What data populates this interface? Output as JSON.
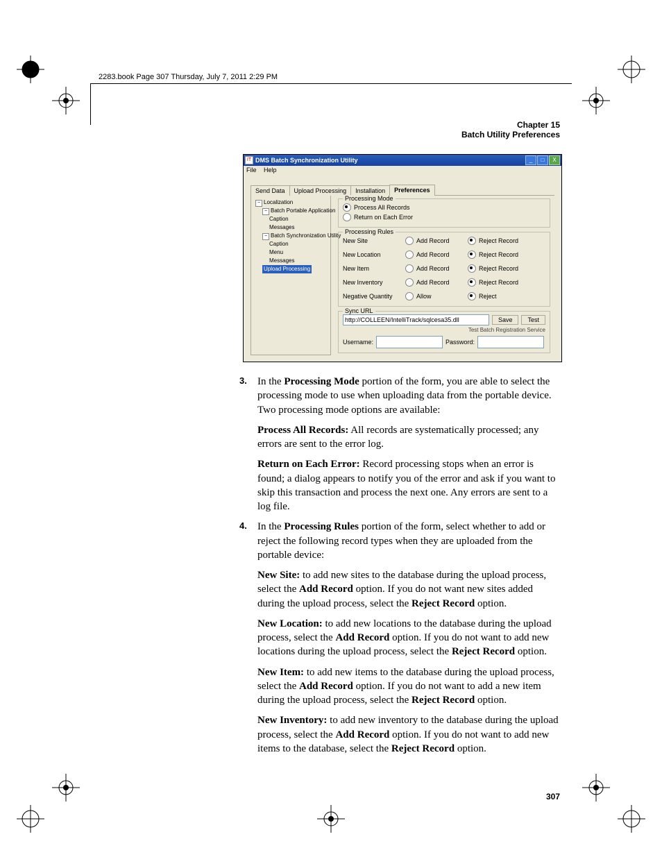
{
  "crop_text": "2283.book  Page 307  Thursday, July 7, 2011  2:29 PM",
  "header": {
    "chapter": "Chapter 15",
    "title": "Batch Utility Preferences"
  },
  "page_number": "307",
  "app": {
    "title": "DMS Batch Synchronization Utility",
    "icon": "IT",
    "win": {
      "min": "_",
      "max": "□",
      "close": "X"
    },
    "menu": {
      "file": "File",
      "help": "Help"
    },
    "tabs": {
      "send": "Send Data",
      "upload": "Upload Processing",
      "install": "Installation",
      "prefs": "Preferences"
    },
    "tree": {
      "root": "Localization",
      "bpa": "Batch Portable Application",
      "caption1": "Caption",
      "messages1": "Messages",
      "bsu": "Batch Synchronization Utility",
      "caption2": "Caption",
      "menu": "Menu",
      "messages2": "Messages",
      "upload": "Upload Processing"
    },
    "proc_mode": {
      "legend": "Processing Mode",
      "all": "Process All Records",
      "ret": "Return on Each Error"
    },
    "rules": {
      "legend": "Processing Rules",
      "new_site": "New Site",
      "new_loc": "New Location",
      "new_item": "New Item",
      "new_inv": "New Inventory",
      "neg_qty": "Negative Quantity",
      "add": "Add Record",
      "reject_rec": "Reject Record",
      "allow": "Allow",
      "reject": "Reject"
    },
    "sync": {
      "legend": "Sync URL",
      "url": "http://COLLEEN/IntelliTrack/sqlcesa35.dll",
      "save": "Save",
      "test": "Test",
      "sub": "Test Batch Registration Service",
      "user_lbl": "Username:",
      "pass_lbl": "Password:"
    }
  },
  "body": {
    "s3_a": "In the ",
    "s3_b": "Processing Mode",
    "s3_c": " portion of the form, you are able to select the processing mode to use when uploading data from the portable device. Two processing mode options are available:",
    "par_b": "Process All Records:",
    "par_c": " All records are systematically processed; any errors are sent to the error log.",
    "roe_b": "Return on Each Error:",
    "roe_c": " Record processing stops when an error is found; a dialog appears to notify you of the error and ask if you want to skip this transaction and process the next one. Any errors are sent to a log file.",
    "s4_a": "In the ",
    "s4_b": "Processing Rules",
    "s4_c": " portion of the form, select whether to add or reject the following record types when they are uploaded from the portable device:",
    "ns_b": "New Site:",
    "ns_c": " to add new sites to the database during the upload process, select the ",
    "ns_d": "Add Record",
    "ns_e": " option. If you do not want new sites added during the upload process, select the ",
    "ns_f": "Reject Record",
    "ns_g": " option.",
    "nl_b": "New Location:",
    "nl_c": " to add new locations to the database during the upload process, select the ",
    "nl_d": "Add Record",
    "nl_e": " option. If you do not want to add new locations during the upload process, select the ",
    "nl_f": "Reject Record",
    "nl_g": " option.",
    "ni_b": "New Item:",
    "ni_c": " to add new items to the database during the upload process, select the ",
    "ni_d": "Add Record",
    "ni_e": " option. If you do not want to add a new item during the upload process, select the ",
    "ni_f": "Reject Record",
    "ni_g": " option.",
    "nv_b": "New Inventory:",
    "nv_c": " to add new inventory to the database during the upload process, select the ",
    "nv_d": "Add Record",
    "nv_e": " option. If you do not want to add new items to the database, select the ",
    "nv_f": "Reject Record",
    "nv_g": " option."
  }
}
